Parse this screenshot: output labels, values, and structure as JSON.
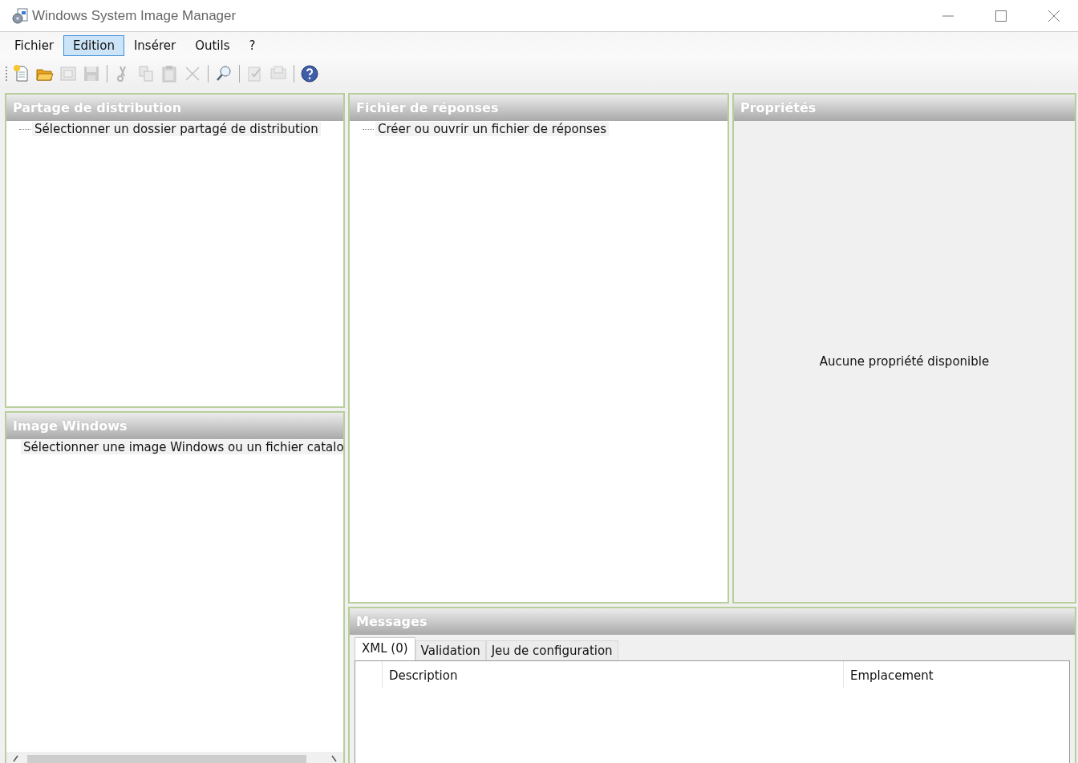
{
  "window": {
    "title": "Windows System Image Manager"
  },
  "menu": [
    {
      "label": "Fichier",
      "highlighted": false
    },
    {
      "label": "Edition",
      "highlighted": true
    },
    {
      "label": "Insérer",
      "highlighted": false
    },
    {
      "label": "Outils",
      "highlighted": false
    },
    {
      "label": "?",
      "highlighted": false
    }
  ],
  "toolbar": [
    {
      "kind": "new",
      "disabled": false
    },
    {
      "kind": "open",
      "disabled": false
    },
    {
      "kind": "close",
      "disabled": true
    },
    {
      "kind": "save",
      "disabled": true
    },
    {
      "kind": "separator"
    },
    {
      "kind": "cut",
      "disabled": true
    },
    {
      "kind": "copy",
      "disabled": true
    },
    {
      "kind": "paste",
      "disabled": true
    },
    {
      "kind": "delete",
      "disabled": true
    },
    {
      "kind": "separator"
    },
    {
      "kind": "find",
      "disabled": false
    },
    {
      "kind": "separator"
    },
    {
      "kind": "validate",
      "disabled": true
    },
    {
      "kind": "catalog",
      "disabled": true
    },
    {
      "kind": "separator"
    },
    {
      "kind": "help",
      "disabled": false
    }
  ],
  "distribution_share": {
    "title": "Partage de distribution",
    "items": [
      "Sélectionner un dossier partagé de distribution"
    ]
  },
  "windows_image": {
    "title": "Image Windows",
    "items": [
      "Sélectionner une image Windows ou un fichier catalo"
    ]
  },
  "answer_file": {
    "title": "Fichier de réponses",
    "items": [
      "Créer ou ouvrir un fichier de réponses"
    ]
  },
  "properties": {
    "title": "Propriétés",
    "message": "Aucune propriété disponible"
  },
  "messages": {
    "title": "Messages",
    "tabs": [
      {
        "label": "XML (0)",
        "selected": true
      },
      {
        "label": "Validation",
        "selected": false
      },
      {
        "label": "Jeu de configuration",
        "selected": false
      }
    ],
    "columns": [
      "Description",
      "Emplacement"
    ]
  }
}
